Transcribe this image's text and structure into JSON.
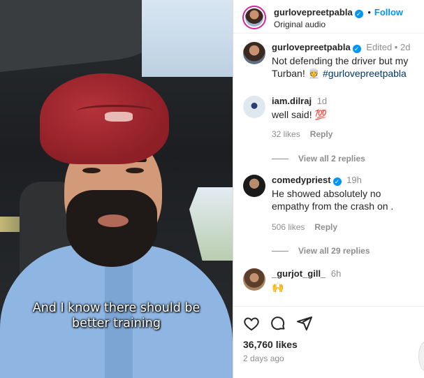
{
  "video": {
    "caption_line1": "And I know there should be",
    "caption_line2": "better training"
  },
  "header": {
    "username": "gurlovepreetpabla",
    "follow_label": "Follow",
    "audio_label": "Original audio",
    "separator": "•"
  },
  "comments": [
    {
      "username": "gurlovepreetpabla",
      "verified": true,
      "time": "Edited • 2d",
      "text": "Not defending the driver but my Turban! 👳",
      "tag": "#gurlovepreetpabla"
    },
    {
      "username": "iam.dilraj",
      "verified": false,
      "time": "1d",
      "text": "well said! 💯",
      "likes": "32 likes",
      "reply": "Reply",
      "view_replies": "View all 2 replies"
    },
    {
      "username": "comedypriest",
      "verified": true,
      "time": "19h",
      "text": "He showed absolutely no empathy from the crash on .",
      "likes": "506 likes",
      "reply": "Reply",
      "view_replies": "View all 29 replies"
    },
    {
      "username": "_gurjot_gill_",
      "verified": false,
      "time": "6h",
      "text": "🙌"
    }
  ],
  "footer": {
    "likes_count": "36,760 likes",
    "posted": "2 days ago",
    "icons": [
      "heart-icon",
      "comment-icon",
      "share-icon"
    ]
  },
  "colors": {
    "accent": "#0095f6",
    "link": "#00376b",
    "muted": "#8e8e8e",
    "text": "#262626"
  }
}
